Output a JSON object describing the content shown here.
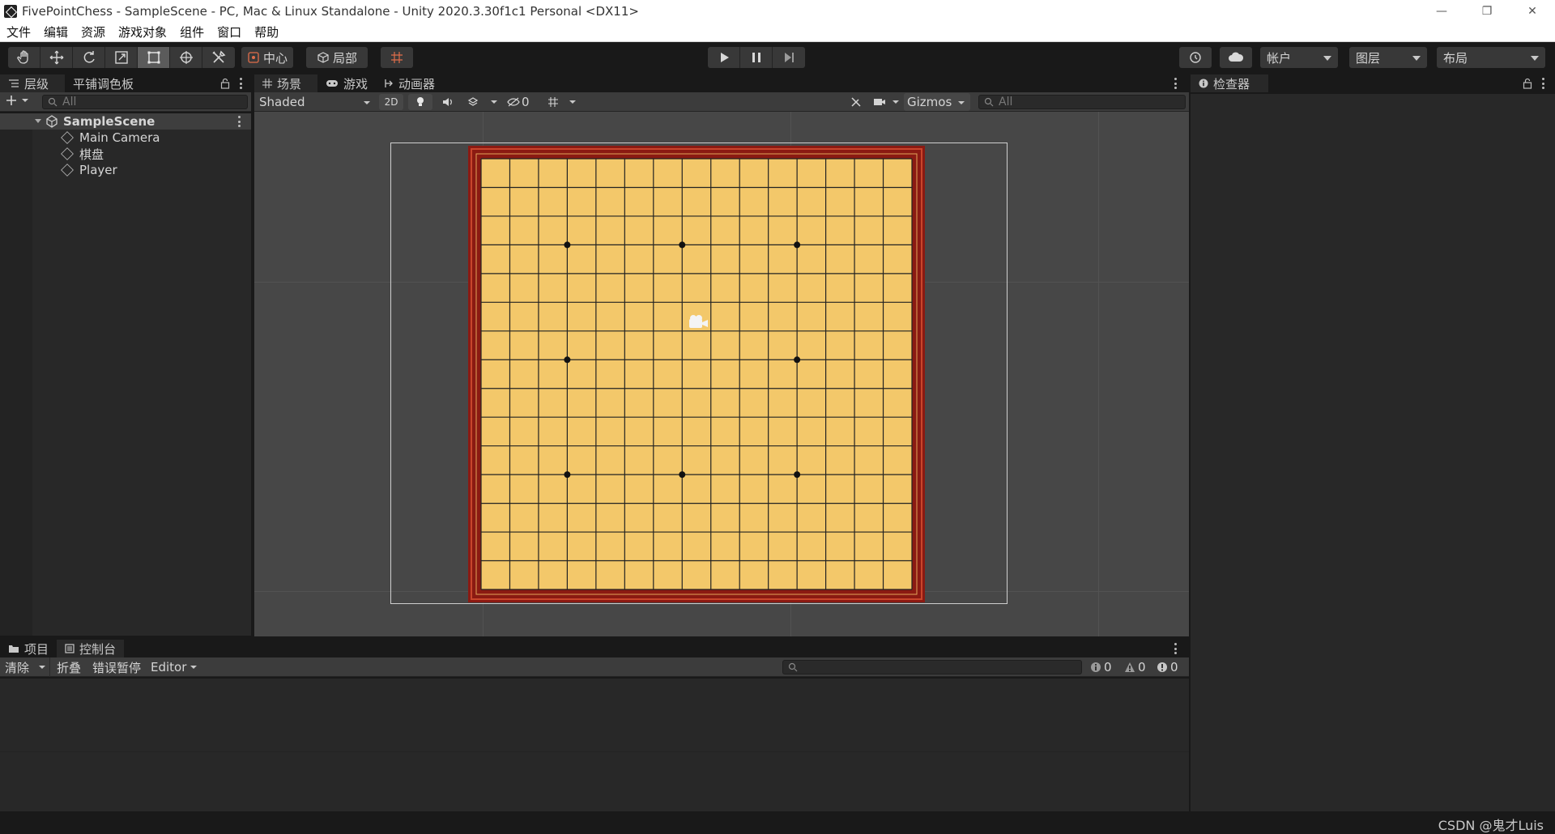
{
  "window": {
    "title": "FivePointChess - SampleScene - PC, Mac & Linux Standalone - Unity 2020.3.30f1c1 Personal <DX11>",
    "controls": [
      "—",
      "❐",
      "✕"
    ]
  },
  "menu": [
    "文件",
    "编辑",
    "资源",
    "游戏对象",
    "组件",
    "窗口",
    "帮助"
  ],
  "toolbar": {
    "pivot_label": "中心",
    "space_label": "局部",
    "account_label": "帐户",
    "layers_label": "图层",
    "layout_label": "布局"
  },
  "hierarchy": {
    "tab_label": "层级",
    "tab2_label": "平铺调色板",
    "search_placeholder": "All",
    "scene_name": "SampleScene",
    "objects": [
      "Main Camera",
      "棋盘",
      "Player"
    ]
  },
  "scene": {
    "tab_scene": "场景",
    "tab_game": "游戏",
    "tab_animator": "动画器",
    "shading_mode": "Shaded",
    "mode_2d": "2D",
    "hidden_count": "0",
    "gizmos_label": "Gizmos",
    "search_placeholder": "All"
  },
  "board": {
    "lines": 15,
    "star_points": [
      [
        3,
        3
      ],
      [
        7,
        3
      ],
      [
        11,
        3
      ],
      [
        3,
        7
      ],
      [
        11,
        7
      ],
      [
        3,
        11
      ],
      [
        7,
        11
      ],
      [
        11,
        11
      ]
    ],
    "board_color": "#f3c86a",
    "frame_color": "#8b1a12"
  },
  "console": {
    "tab_project": "项目",
    "tab_console": "控制台",
    "clear_label": "清除",
    "collapse_label": "折叠",
    "error_pause_label": "错误暂停",
    "editor_label": "Editor",
    "info_count": "0",
    "warning_count": "0",
    "error_count": "0"
  },
  "inspector": {
    "tab_label": "检查器"
  },
  "watermark": "CSDN @鬼才Luis"
}
